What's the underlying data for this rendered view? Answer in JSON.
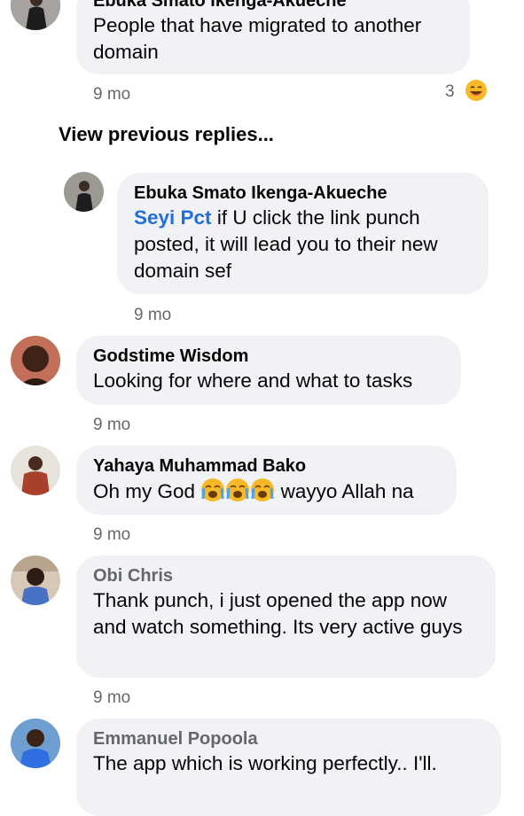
{
  "comments": [
    {
      "name": "Ebuka Smato Ikenga-Akueche",
      "text": "People that have migrated to another domain",
      "time": "9 mo",
      "reaction_count": "3",
      "reaction": "laughing-emoji"
    },
    {
      "name": "Ebuka Smato Ikenga-Akueche",
      "mention": "Seyi Pct",
      "text": " if U click the link punch posted, it will lead you to their new domain sef",
      "time": "9 mo"
    },
    {
      "name": "Godstime Wisdom",
      "text": "Looking for where and what to tasks",
      "time": "9 mo"
    },
    {
      "name": "Yahaya Muhammad Bako",
      "text_before": "Oh my God",
      "text_after": "wayyo Allah na",
      "emoji": "crying-emoji",
      "time": "9 mo"
    },
    {
      "name": "Obi Chris",
      "text": "Thank punch, i just opened the app now and watch something. Its very active guys",
      "time": "9 mo"
    },
    {
      "name": "Emmanuel Popoola",
      "text": "The app which is working perfectly.. I'll."
    }
  ],
  "view_previous_replies": "View previous replies..."
}
